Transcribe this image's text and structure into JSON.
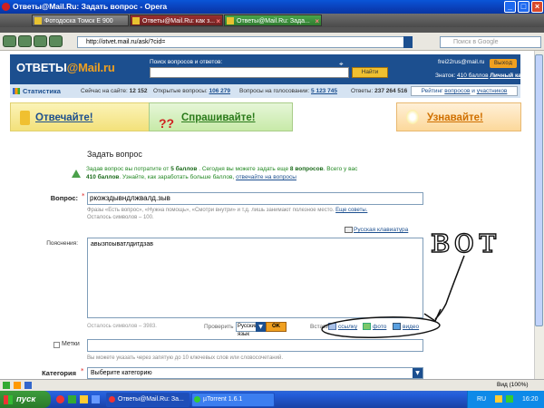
{
  "window": {
    "title": "Ответы@Mail.Ru: Задать вопрос - Opera"
  },
  "tabs": [
    {
      "label": "Фотодоска Томск Е 900"
    },
    {
      "label": "Ответы@Mail.Ru: как з..."
    },
    {
      "label": "Ответы@Mail.Ru: Зада..."
    }
  ],
  "address": {
    "url": "http://otvet.mail.ru/ask/?cid=",
    "search_placeholder": "Поиск в Google"
  },
  "site": {
    "logo_main": "ОТВЕТЫ",
    "logo_domain": "@Mail.ru",
    "search_label": "Поиск вопросов и ответов:",
    "search_button": "Найти",
    "user_email": "frei22rus@mail.ru",
    "logout": "Выход",
    "knowledge_prefix": "Знаток:",
    "points": "410 баллов",
    "cabinet": "Личный кабинет"
  },
  "stats": {
    "label": "Статистика",
    "online_label": "Сейчас на сайте:",
    "online": "12 152",
    "open_label": "Открытые вопросы:",
    "open": "106 279",
    "vote_label": "Вопросы на голосовании:",
    "vote": "5 123 745",
    "answers_label": "Ответы:",
    "answers": "237 264 516",
    "rating_prefix": "Рейтинг",
    "rating_q": "вопросов",
    "rating_and": "и",
    "rating_p": "участников"
  },
  "actions": {
    "answer": "Отвечайте!",
    "ask": "Спрашивайте!",
    "learn": "Узнавайте!"
  },
  "form": {
    "title": "Задать вопрос",
    "tip_line1a": "Задав вопрос вы потратите от",
    "tip_cost": "5 баллов",
    "tip_line1b": ". Сегодня вы можете задать еще",
    "tip_count": "8 вопросов",
    "tip_line1c": ". Всего у вас",
    "tip_total": "410 баллов",
    "tip_line2": ". Узнайте, как заработать больше баллов,",
    "tip_link": "отвечайте на вопросы",
    "question_label": "Вопрос:",
    "question_value": "ркожздывндлжвалд.зыв",
    "question_hint": "Фразы «Есть вопрос», «Нужна помощь», «Смотри внутри» и т.д. лишь занимают полезное место.",
    "question_hint_link": "Еще советы.",
    "question_left": "Осталось символов – 100.",
    "keyboard": "Русская клавиатура",
    "desc_label": "Пояснения:",
    "desc_value": "авызпоыватлдитдзав",
    "desc_left": "Осталось символов – 3983.",
    "check_label": "Проверить",
    "lang": "Русский язык",
    "ok": "OK",
    "insert_label": "Вставить:",
    "insert_link": "ссылку",
    "insert_photo": "фото",
    "insert_video": "видео",
    "tags_label": "Метки",
    "tags_hint": "Вы можете указать через запятую до 10 ключевых слов или словосочетаний.",
    "category_label": "Категория",
    "category_value": "Выберите категорию"
  },
  "annotation": {
    "text": "вот"
  },
  "statusbar": {
    "zoom": "Вид (100%)"
  },
  "taskbar": {
    "start": "пуск",
    "buttons": [
      "Ответы@Mail.Ru: За...",
      "µTorrent 1.6.1"
    ],
    "lang": "RU",
    "time": "16:20"
  }
}
